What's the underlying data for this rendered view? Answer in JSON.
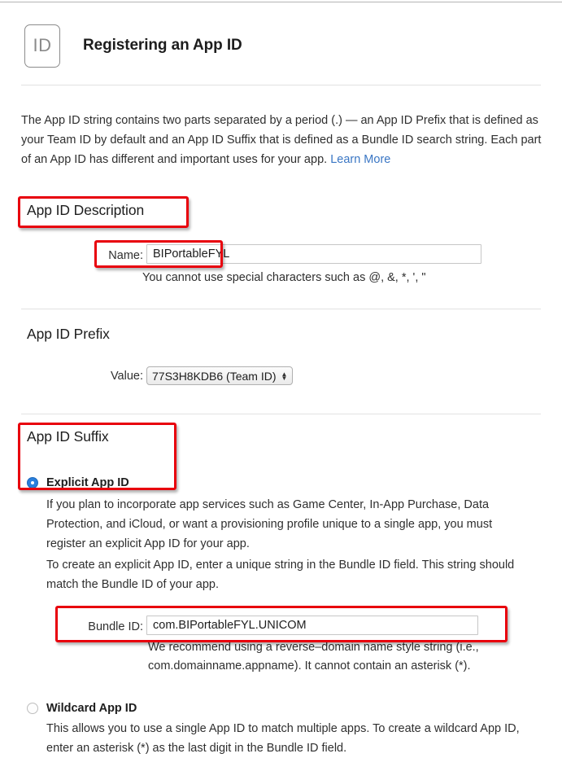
{
  "header": {
    "badge_text": "ID",
    "badge_icon": "app-id-badge-icon",
    "title": "Registering an App ID"
  },
  "intro": {
    "text": "The App ID string contains two parts separated by a period (.) — an App ID Prefix that is defined as your Team ID by default and an App ID Suffix that is defined as a Bundle ID search string. Each part of an App ID has different and important uses for your app. ",
    "learn_more_label": "Learn More",
    "link_color": "#3a76c4"
  },
  "app_id_description": {
    "heading": "App ID Description",
    "name_label": "Name:",
    "name_value": "BIPortableFYL",
    "name_placeholder": "",
    "name_helper": "You cannot use special characters such as @, &, *, ', \""
  },
  "app_id_prefix": {
    "heading": "App ID Prefix",
    "value_label": "Value:",
    "value_selected": "77S3H8KDB6 (Team ID)",
    "stepper_icon": "stepper-up-down-icon"
  },
  "app_id_suffix": {
    "heading": "App ID Suffix",
    "explicit": {
      "label": "Explicit App ID",
      "selected": true,
      "paragraph_1": "If you plan to incorporate app services such as Game Center, In-App Purchase, Data Protection, and iCloud, or want a provisioning profile unique to a single app, you must register an explicit App ID for your app.",
      "paragraph_2": "To create an explicit App ID, enter a unique string in the Bundle ID field. This string should match the Bundle ID of your app.",
      "bundle_label": "Bundle ID:",
      "bundle_value": "com.BIPortableFYL.UNICOM",
      "bundle_placeholder": "",
      "bundle_helper": "We recommend using a reverse–domain name style string (i.e., com.domainname.appname). It cannot contain an asterisk (*)."
    },
    "wildcard": {
      "label": "Wildcard App ID",
      "selected": false,
      "paragraph": "This allows you to use a single App ID to match multiple apps. To create a wildcard App ID, enter an asterisk (*) as the last digit in the Bundle ID field."
    }
  },
  "annotations": {
    "color": "#e8000d",
    "boxes": [
      "app-id-description-heading",
      "name-field-row",
      "app-id-suffix-section",
      "bundle-id-field-row"
    ]
  },
  "theme": {
    "background": "#ffffff",
    "text": "#2f2f2f",
    "radio_on": "#2a7fdc",
    "divider": "#e2e2e2"
  }
}
